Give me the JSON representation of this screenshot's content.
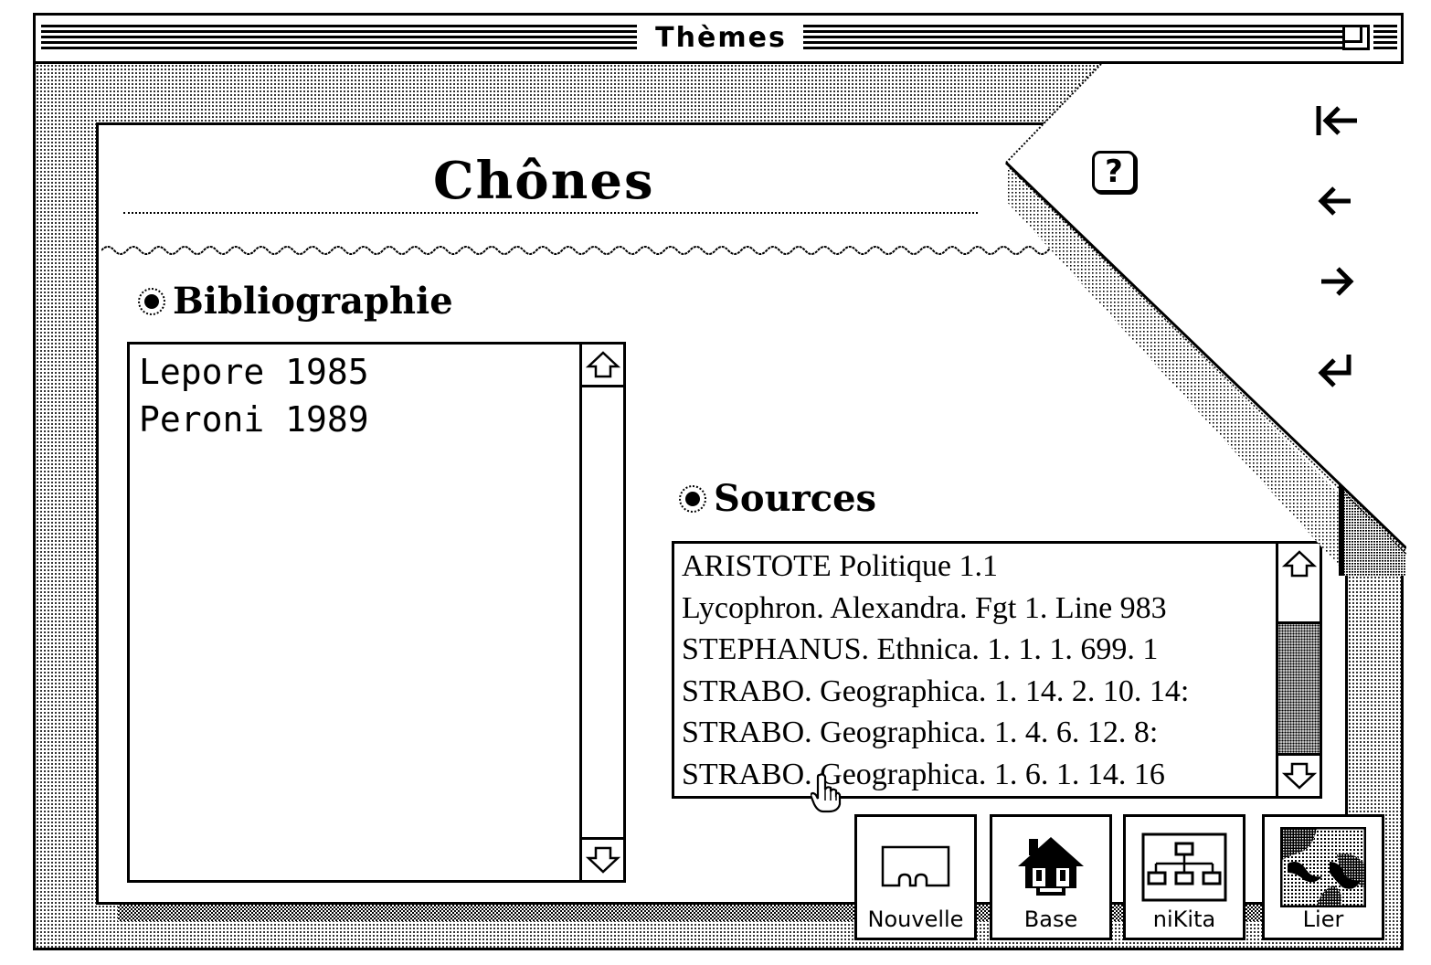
{
  "window": {
    "title": "Thèmes"
  },
  "page": {
    "heading": "Chônes",
    "help_label": "?"
  },
  "bibliographie": {
    "label": "Bibliographie",
    "selected": true,
    "items": [
      "Lepore 1985",
      "Peroni 1989"
    ]
  },
  "sources": {
    "label": "Sources",
    "selected": true,
    "items": [
      "ARISTOTE Politique 1.1",
      "Lycophron. Alexandra. Fgt 1. Line 983",
      "STEPHANUS. Ethnica. 1. 1. 1. 699. 1",
      "STRABO. Geographica. 1. 14. 2. 10. 14:",
      "STRABO. Geographica. 1. 4. 6. 12. 8:",
      "STRABO. Geographica. 1. 6. 1. 14. 16"
    ]
  },
  "navigation": [
    {
      "name": "first-card",
      "icon": "arrow-first-icon"
    },
    {
      "name": "previous-card",
      "icon": "arrow-left-icon"
    },
    {
      "name": "next-card",
      "icon": "arrow-right-icon"
    },
    {
      "name": "return",
      "icon": "return-arrow-icon"
    }
  ],
  "toolbar": {
    "nouvelle": "Nouvelle",
    "base": "Base",
    "nikita": "niKita",
    "lier": "Lier"
  }
}
